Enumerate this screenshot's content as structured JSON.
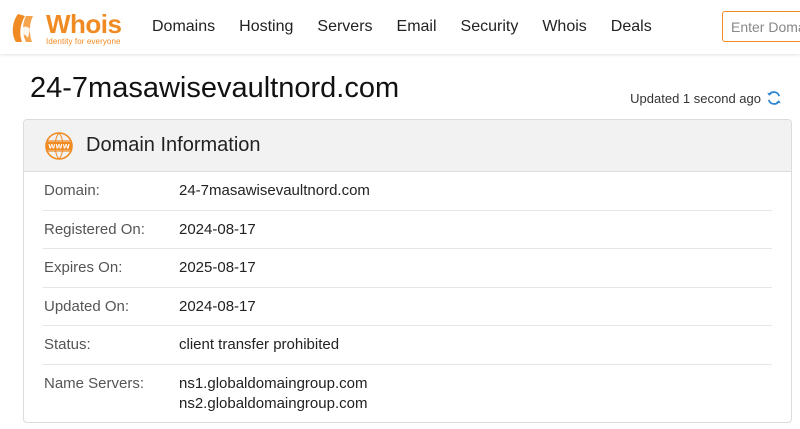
{
  "brand": {
    "name": "Whois",
    "tagline": "Identity for everyone",
    "color": "#f08a22"
  },
  "nav": {
    "items": [
      {
        "label": "Domains"
      },
      {
        "label": "Hosting"
      },
      {
        "label": "Servers"
      },
      {
        "label": "Email"
      },
      {
        "label": "Security"
      },
      {
        "label": "Whois"
      },
      {
        "label": "Deals"
      }
    ]
  },
  "search": {
    "placeholder": "Enter Domain or IP"
  },
  "page": {
    "title": "24-7masawisevaultnord.com",
    "updated": "Updated 1 second ago"
  },
  "domain_info": {
    "title": "Domain Information",
    "icon": "www-icon",
    "rows": [
      {
        "label": "Domain:",
        "value": "24-7masawisevaultnord.com"
      },
      {
        "label": "Registered On:",
        "value": "2024-08-17"
      },
      {
        "label": "Expires On:",
        "value": "2025-08-17"
      },
      {
        "label": "Updated On:",
        "value": "2024-08-17"
      },
      {
        "label": "Status:",
        "value": "client transfer prohibited"
      }
    ],
    "name_servers": {
      "label": "Name Servers:",
      "values": [
        "ns1.globaldomaingroup.com",
        "ns2.globaldomaingroup.com"
      ]
    }
  }
}
